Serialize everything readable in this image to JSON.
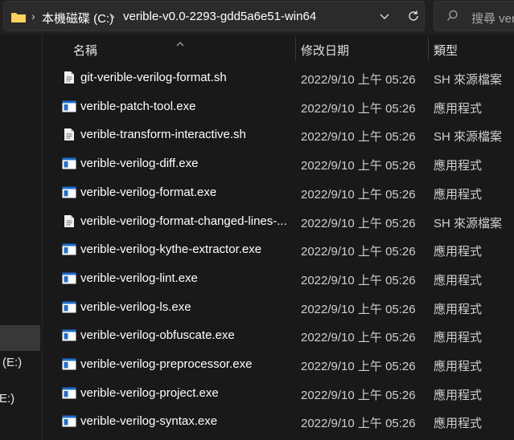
{
  "address_bar": {
    "crumbs": [
      "本機磁碟 (C:)",
      "verible-v0.0-2293-gdd5a6e51-win64"
    ]
  },
  "search": {
    "placeholder": "搜尋 veri"
  },
  "nav": {
    "drives": [
      {
        "label": "(E:)"
      },
      {
        "label": "E:)"
      }
    ]
  },
  "columns": {
    "name": "名稱",
    "date": "修改日期",
    "type": "類型"
  },
  "files": [
    {
      "name": "git-verible-verilog-format.sh",
      "date": "2022/9/10 上午 05:26",
      "type": "SH 來源檔案",
      "icon": "script-file-icon"
    },
    {
      "name": "verible-patch-tool.exe",
      "date": "2022/9/10 上午 05:26",
      "type": "應用程式",
      "icon": "exe-file-icon"
    },
    {
      "name": "verible-transform-interactive.sh",
      "date": "2022/9/10 上午 05:26",
      "type": "SH 來源檔案",
      "icon": "script-file-icon"
    },
    {
      "name": "verible-verilog-diff.exe",
      "date": "2022/9/10 上午 05:26",
      "type": "應用程式",
      "icon": "exe-file-icon"
    },
    {
      "name": "verible-verilog-format.exe",
      "date": "2022/9/10 上午 05:26",
      "type": "應用程式",
      "icon": "exe-file-icon"
    },
    {
      "name": "verible-verilog-format-changed-lines-...",
      "date": "2022/9/10 上午 05:26",
      "type": "SH 來源檔案",
      "icon": "script-file-icon"
    },
    {
      "name": "verible-verilog-kythe-extractor.exe",
      "date": "2022/9/10 上午 05:26",
      "type": "應用程式",
      "icon": "exe-file-icon"
    },
    {
      "name": "verible-verilog-lint.exe",
      "date": "2022/9/10 上午 05:26",
      "type": "應用程式",
      "icon": "exe-file-icon"
    },
    {
      "name": "verible-verilog-ls.exe",
      "date": "2022/9/10 上午 05:26",
      "type": "應用程式",
      "icon": "exe-file-icon"
    },
    {
      "name": "verible-verilog-obfuscate.exe",
      "date": "2022/9/10 上午 05:26",
      "type": "應用程式",
      "icon": "exe-file-icon"
    },
    {
      "name": "verible-verilog-preprocessor.exe",
      "date": "2022/9/10 上午 05:26",
      "type": "應用程式",
      "icon": "exe-file-icon"
    },
    {
      "name": "verible-verilog-project.exe",
      "date": "2022/9/10 上午 05:26",
      "type": "應用程式",
      "icon": "exe-file-icon"
    },
    {
      "name": "verible-verilog-syntax.exe",
      "date": "2022/9/10 上午 05:26",
      "type": "應用程式",
      "icon": "exe-file-icon"
    }
  ],
  "colors": {
    "background": "#191919",
    "toolbar": "#202020",
    "field": "#2b2b2b",
    "folder": "#f5c342",
    "exe_accent": "#1f6fd1"
  }
}
